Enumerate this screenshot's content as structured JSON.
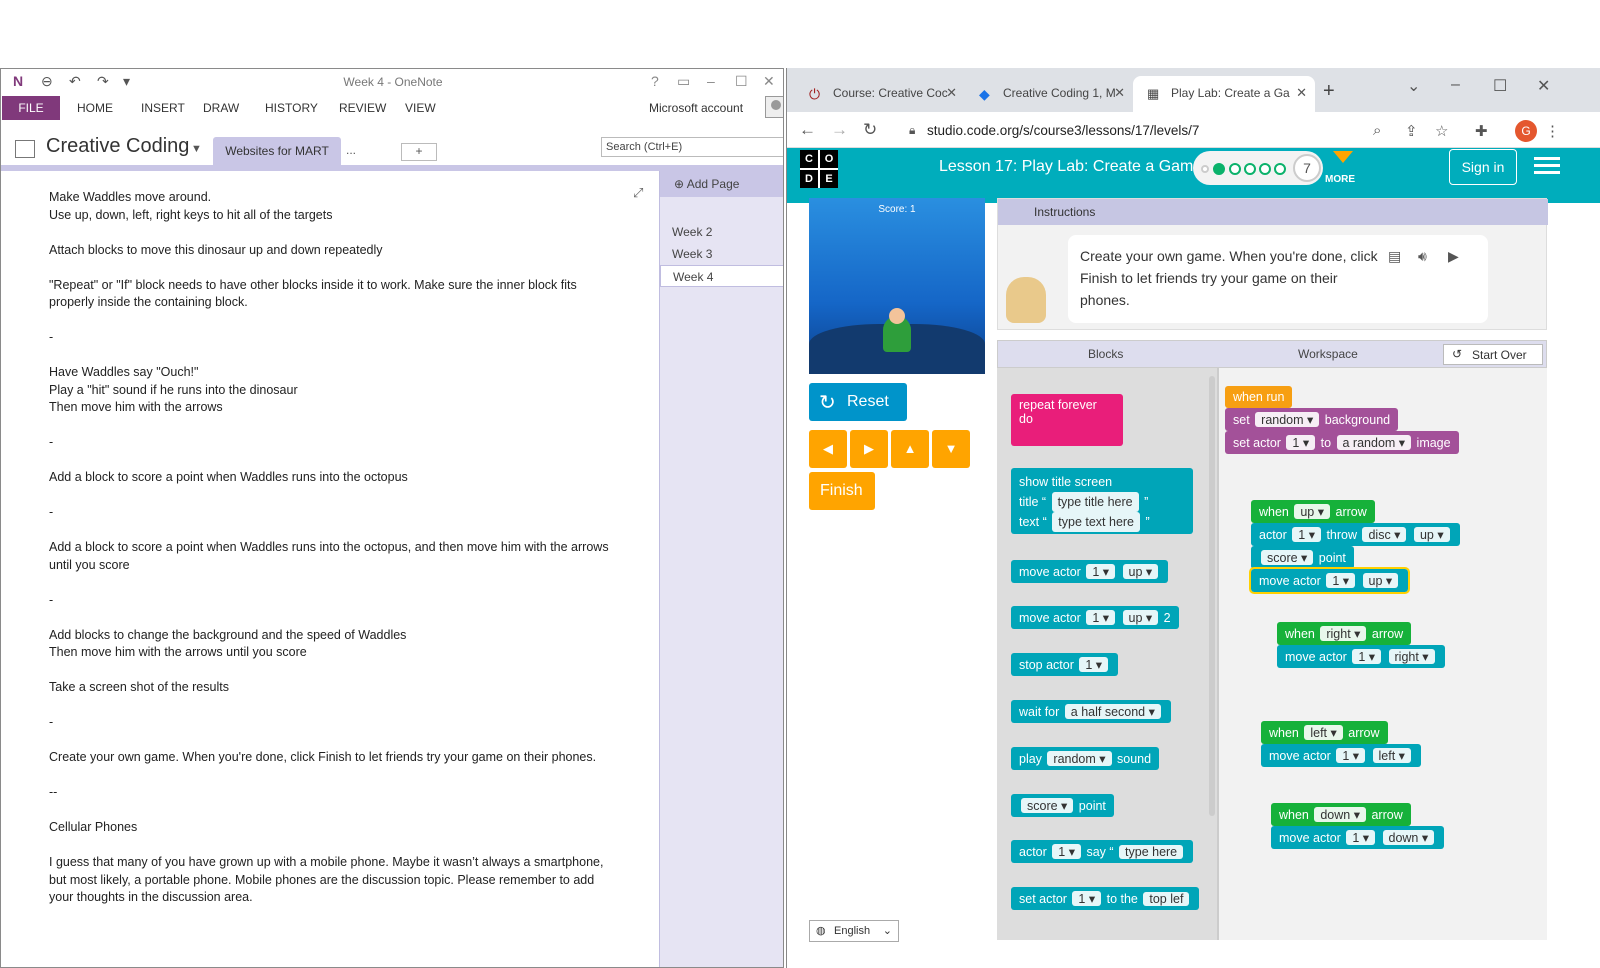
{
  "onenote": {
    "title": "Week 4 - OneNote",
    "menu": {
      "file": "FILE",
      "items": [
        "HOME",
        "INSERT",
        "DRAW",
        "HISTORY",
        "REVIEW",
        "VIEW"
      ],
      "account": "Microsoft account"
    },
    "notebook": "Creative Coding",
    "section": "Websites for MART",
    "section_more": "...",
    "search_placeholder": "Search (Ctrl+E)",
    "add_page": "Add Page",
    "pages": [
      "Week 2",
      "Week 3",
      "Week 4"
    ],
    "content": [
      "Make Waddles move around.",
      "Use up, down, left, right keys to hit all of the targets",
      "",
      "Attach blocks to move this dinosaur up and down repeatedly",
      "",
      "\"Repeat\" or \"If\" block needs to have other blocks inside it to work. Make sure the inner block fits properly inside the containing block.",
      "",
      "-",
      "",
      "Have Waddles say \"Ouch!\"",
      "Play a \"hit\" sound if he runs into the dinosaur",
      "Then move him with the arrows",
      "",
      "-",
      "",
      "Add a block to score a point when Waddles runs into the octopus",
      "",
      "-",
      "",
      "Add a block to score a point when Waddles runs into the octopus, and then move him with the arrows until you score",
      "",
      "-",
      "",
      "Add blocks to change the background and the speed of Waddles",
      "Then move him with the arrows until you score",
      "",
      "Take a screen shot of the results",
      "",
      "-",
      "",
      "Create your own game. When you're done, click Finish to let friends try your game on their phones.",
      "",
      "--",
      "",
      "Cellular Phones",
      "",
      "I guess that many of you have grown up with a mobile phone. Maybe it wasn’t always a smartphone, but most likely, a portable phone. Mobile phones are the discussion topic. Please remember to add your thoughts in the discussion area."
    ]
  },
  "chrome": {
    "tabs": [
      "Course: Creative Coc",
      "Creative Coding 1, M",
      "Play Lab: Create a Ga"
    ],
    "url": "studio.code.org/s/course3/lessons/17/levels/7",
    "profile": "G"
  },
  "codeorg": {
    "logo": [
      "C",
      "O",
      "D",
      "E"
    ],
    "lesson": "Lesson 17: Play Lab: Create a Game",
    "level": "7",
    "more": "MORE",
    "signin": "Sign in",
    "score": "Score: 1",
    "reset": "Reset",
    "finish": "Finish",
    "language": "English",
    "instructions_header": "Instructions",
    "instructions": "Create your own game. When you're done, click Finish to let friends try your game on their phones.",
    "tab_blocks": "Blocks",
    "tab_workspace": "Workspace",
    "start_over": "Start Over"
  },
  "colors": {
    "onenote_purple": "#80397b",
    "codeorg_teal": "#00adbc",
    "block_cyan": "#00a5b8",
    "block_green": "#16b13a"
  }
}
